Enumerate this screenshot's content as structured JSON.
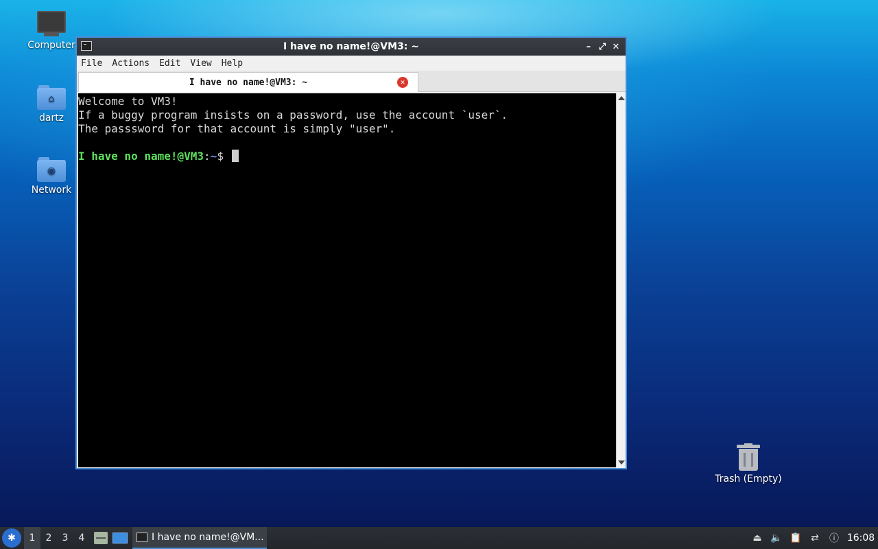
{
  "desktop": {
    "icons": [
      {
        "label": "Computer"
      },
      {
        "label": "dartz"
      },
      {
        "label": "Network"
      },
      {
        "label": "Trash (Empty)"
      }
    ]
  },
  "window": {
    "title": "I have no name!@VM3: ~",
    "menu": [
      "File",
      "Actions",
      "Edit",
      "View",
      "Help"
    ],
    "tab_label": "I have no name!@VM3: ~",
    "terminal": {
      "lines": [
        "Welcome to VM3!",
        "If a buggy program insists on a password, use the account `user`.",
        "The passsword for that account is simply \"user\"."
      ],
      "prompt_user": "I have no name!@VM3",
      "prompt_sep": ":",
      "prompt_path": "~",
      "prompt_symbol": "$"
    }
  },
  "taskbar": {
    "workspaces": [
      "1",
      "2",
      "3",
      "4"
    ],
    "active_workspace": "1",
    "task_label": "I have no name!@VM...",
    "clock": "16:08"
  },
  "colors": {
    "accent": "#4a90d9",
    "prompt_user": "#5ee05e",
    "prompt_path": "#6e8ff0"
  }
}
